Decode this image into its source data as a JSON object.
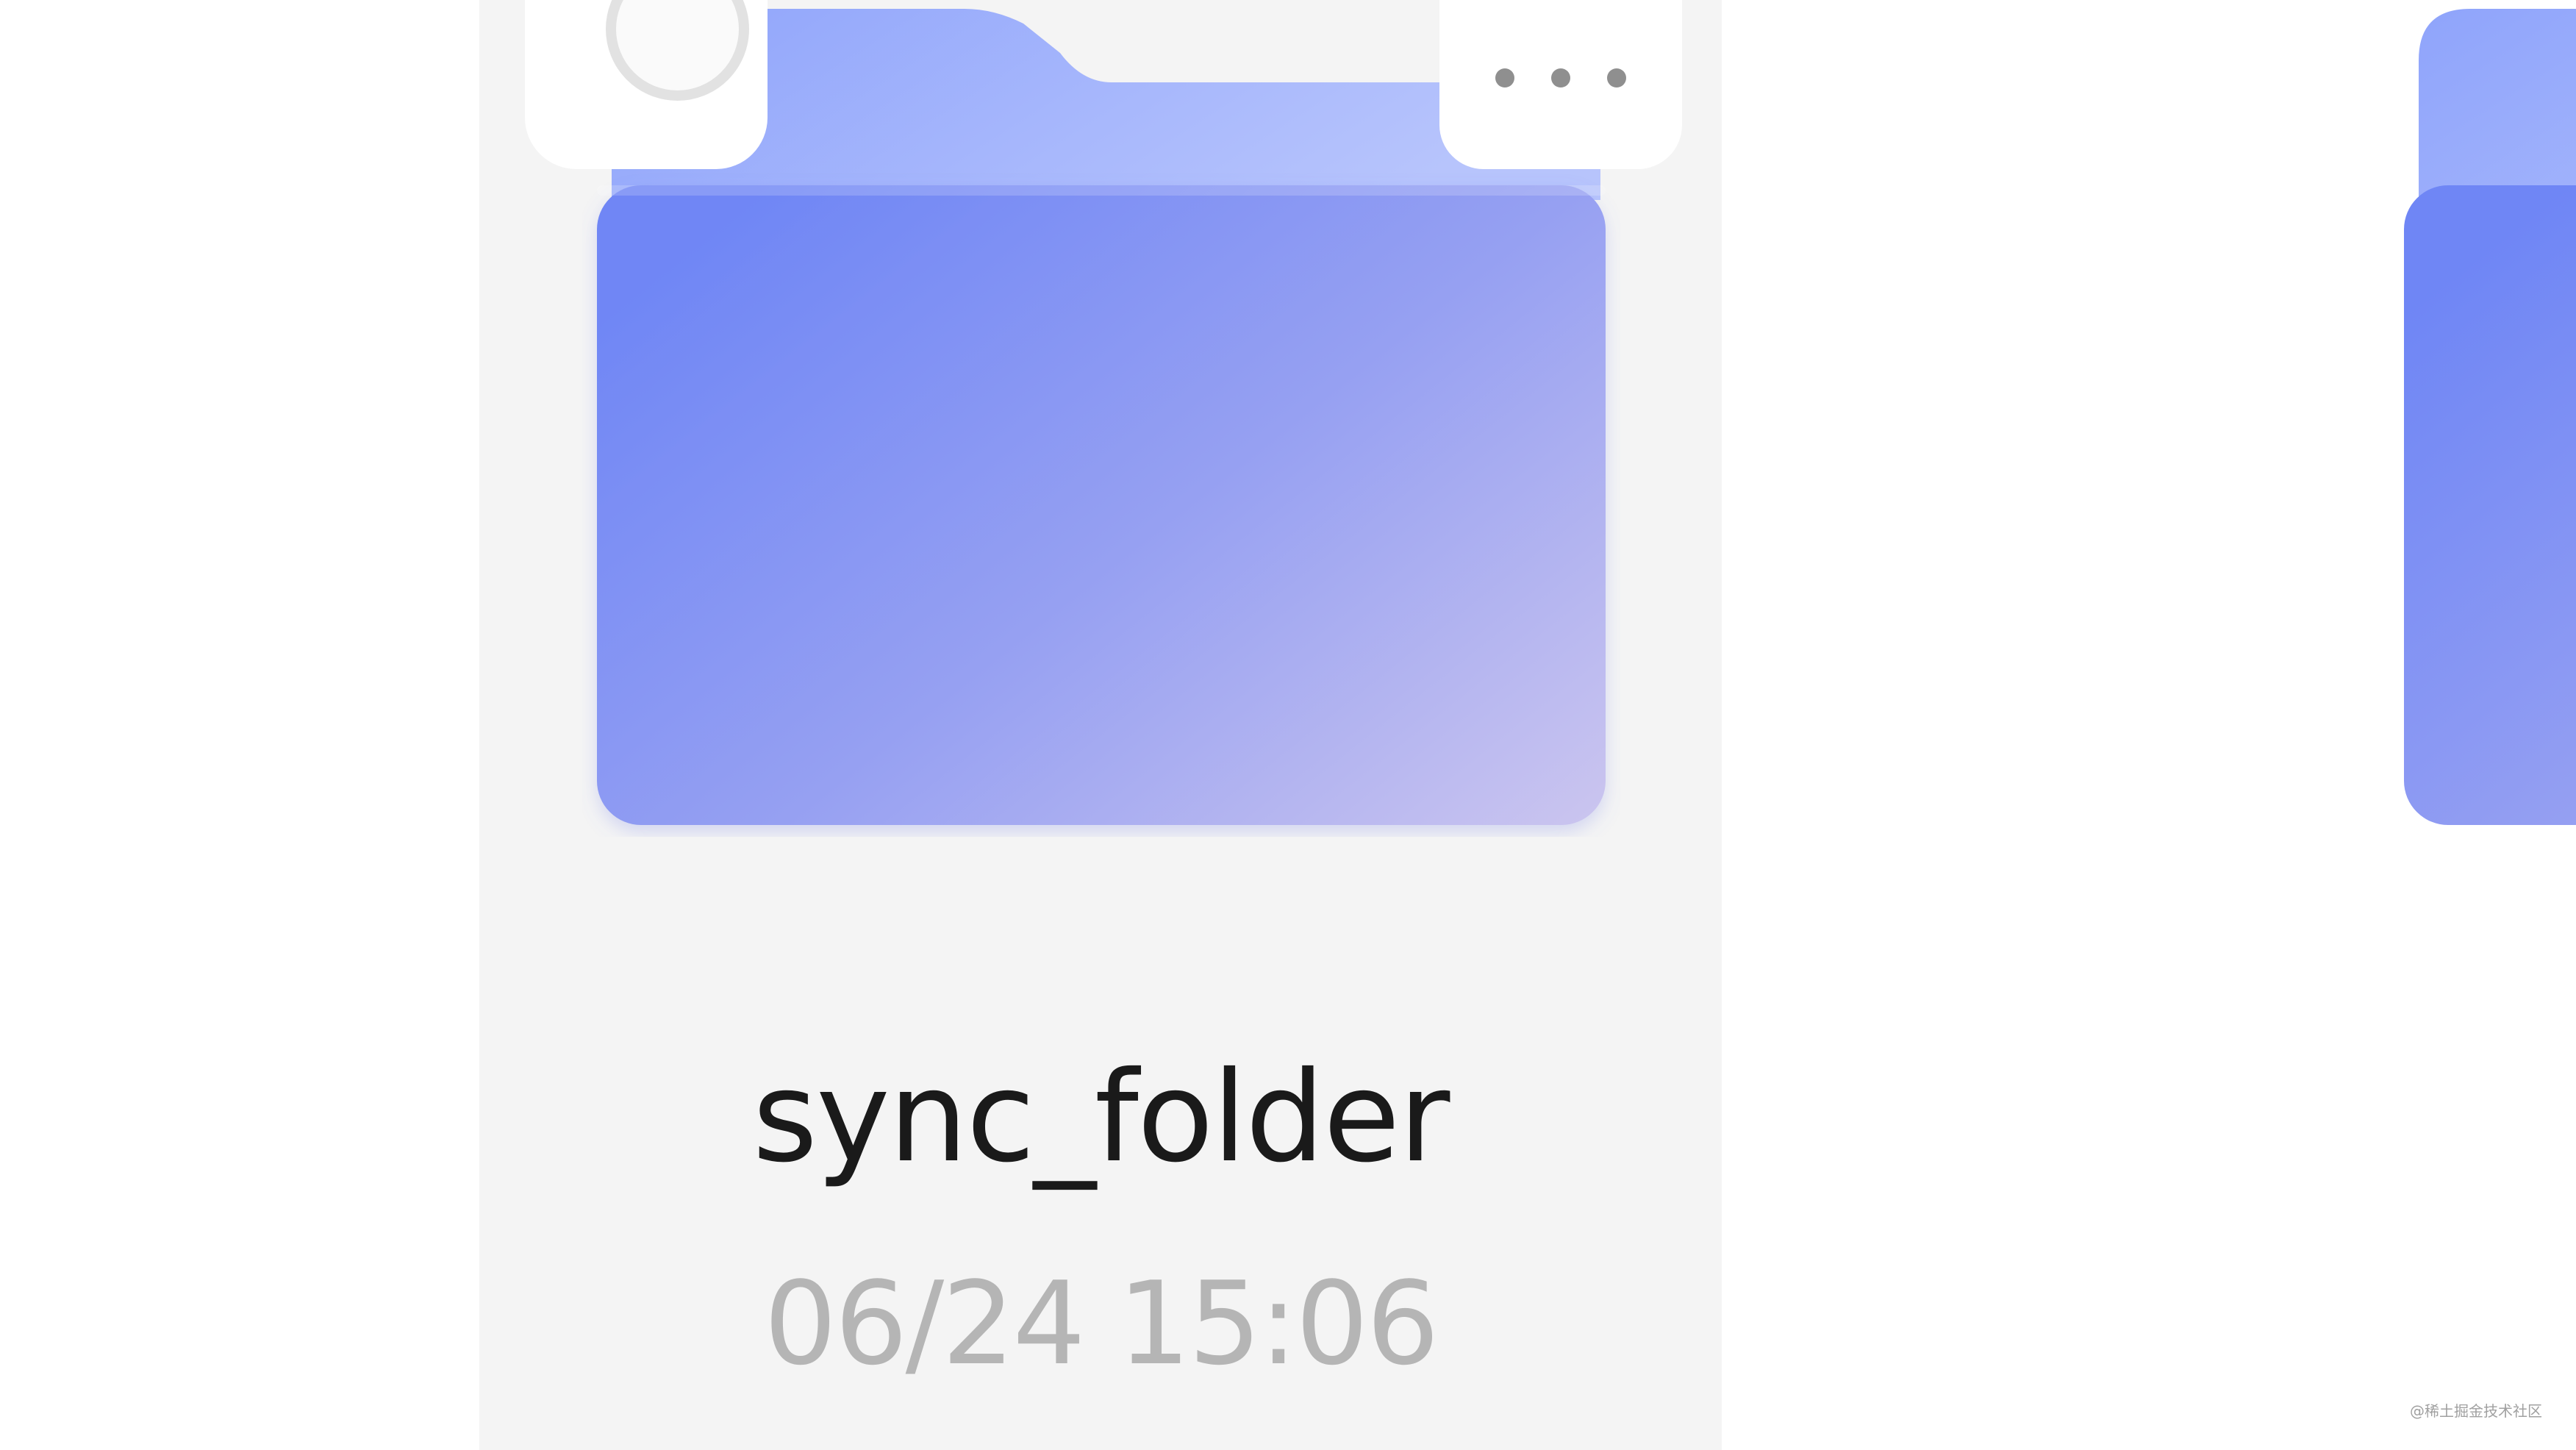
{
  "folder_card": {
    "name": "sync_folder",
    "modified": "06/24 15:06",
    "selected": false,
    "more_icon": "more-horizontal-icon",
    "folder_icon": "folder-icon"
  },
  "watermark": {
    "text": "@稀土掘金技术社区"
  },
  "colors": {
    "card_background": "#f4f4f4",
    "folder_front_start": "#6f86f5",
    "folder_front_end": "#c9c3ef",
    "folder_back_start": "#8fa4fb",
    "folder_back_end": "#b7c4fc",
    "name_text": "#1a1a1a",
    "time_text": "#b5b5b5"
  }
}
